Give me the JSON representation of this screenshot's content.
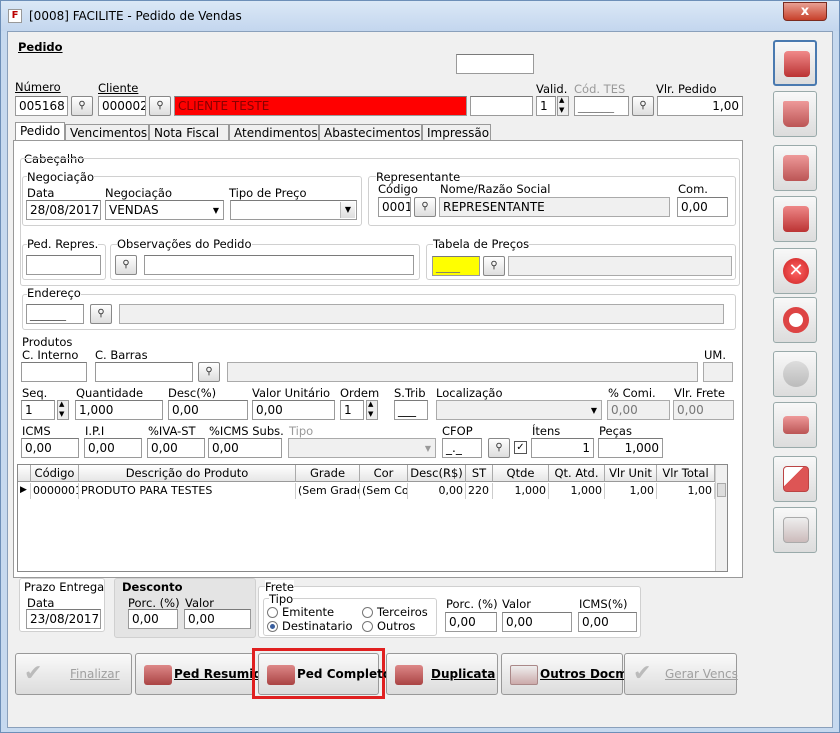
{
  "window": {
    "title": "[0008] FACILITE - Pedido de Vendas",
    "icon": "F",
    "close": "x"
  },
  "header": {
    "section": "Pedido",
    "numero_label": "Número",
    "numero": "005168",
    "cliente_label": "Cliente",
    "cliente_code": "000002",
    "cliente_name": "CLIENTE TESTE",
    "valid_label": "Valid.",
    "valid": "1",
    "cod_tes_label": "Cód. TES",
    "cod_tes": "______",
    "vlr_pedido_label": "Vlr. Pedido",
    "vlr_pedido": "1,00"
  },
  "tabs": [
    "Pedido",
    "Vencimentos",
    "Nota Fiscal",
    "Atendimentos",
    "Abastecimentos",
    "Impressão"
  ],
  "cabecalho": {
    "title": "Cabeçalho",
    "negociacao_title": "Negociação",
    "data_label": "Data",
    "data": "28/08/2017",
    "negociacao_label": "Negociação",
    "negociacao": "VENDAS",
    "tipo_preco_label": "Tipo de Preço",
    "tipo_preco": "",
    "representante_title": "Representante",
    "codigo_label": "Código",
    "codigo": "0001",
    "nome_label": "Nome/Razão Social",
    "nome": "REPRESENTANTE",
    "com_label": "Com.",
    "com": "0,00",
    "ped_repres_label": "Ped. Repres.",
    "ped_repres": "",
    "obs_label": "Observações do Pedido",
    "obs": "",
    "tabela_label": "Tabela de Preços",
    "tabela_code": "____",
    "tabela_desc": "",
    "endereco_label": "Endereço",
    "endereco_code": "______",
    "endereco_desc": ""
  },
  "produtos": {
    "title": "Produtos",
    "c_interno_label": "C. Interno",
    "c_barras_label": "C. Barras",
    "um_label": "UM.",
    "seq_label": "Seq.",
    "seq": "1",
    "quantidade_label": "Quantidade",
    "quantidade": "1,000",
    "desc_label": "Desc(%)",
    "desc": "0,00",
    "vlr_unit_label": "Valor Unitário",
    "vlr_unit": "0,00",
    "ordem_label": "Ordem",
    "ordem": "1",
    "strib_label": "S.Trib",
    "strib": "___",
    "localizacao_label": "Localização",
    "localizacao": "",
    "comi_label": "% Comi.",
    "comi": "0,00",
    "vlr_frete_label": "Vlr. Frete",
    "vlr_frete": "0,00",
    "icms_label": "ICMS",
    "icms": "0,00",
    "ipi_label": "I.P.I",
    "ipi": "0,00",
    "iva_label": "%IVA-ST",
    "iva": "0,00",
    "icms_subs_label": "%ICMS Subs.",
    "icms_subs": "0,00",
    "tipo_label": "Tipo",
    "tipo": "",
    "cfop_label": "CFOP",
    "cfop": "_._",
    "itens_label": "Ítens",
    "itens": "1",
    "pecas_label": "Peças",
    "pecas": "1,000"
  },
  "grid": {
    "columns": [
      "Código",
      "Descrição do Produto",
      "Grade",
      "Cor",
      "Desc(R$)",
      "ST",
      "Qtde",
      "Qt. Atd.",
      "Vlr Unit",
      "Vlr Total"
    ],
    "rows": [
      {
        "codigo": "0000001",
        "descricao": "PRODUTO PARA TESTES",
        "grade": "(Sem Grade",
        "cor": "(Sem Cor)",
        "desc": "0,00",
        "st": "220",
        "qtde": "1,000",
        "qt_atd": "1,000",
        "vlr_unit": "1,00",
        "vlr_total": "1,00"
      }
    ],
    "row_marker": "▶"
  },
  "footer": {
    "prazo_title": "Prazo Entrega",
    "prazo_data_label": "Data",
    "prazo_data": "23/08/2017",
    "desconto_title": "Desconto",
    "desc_porc_label": "Porc. (%)",
    "desc_porc": "0,00",
    "desc_valor_label": "Valor",
    "desc_valor": "0,00",
    "frete_title": "Frete",
    "tipo_label": "Tipo",
    "emitente": "Emitente",
    "terceiros": "Terceiros",
    "destinatario": "Destinatario",
    "outros": "Outros",
    "frete_porc_label": "Porc. (%)",
    "frete_porc": "0,00",
    "frete_valor_label": "Valor",
    "frete_valor": "0,00",
    "frete_icms_label": "ICMS(%)",
    "frete_icms": "0,00"
  },
  "buttons": {
    "finalizar": "Finalizar",
    "ped_resumido": "Ped Resumido",
    "ped_completo": "Ped Completo",
    "duplicata": "Duplicata",
    "outros_docmts": "Outros Docmts",
    "gerar_vencs": "Gerar Vencs"
  },
  "colors": {
    "client_red": "#ff0000",
    "highlight": "#e02020",
    "tabela_yellow": "#ffff00"
  }
}
